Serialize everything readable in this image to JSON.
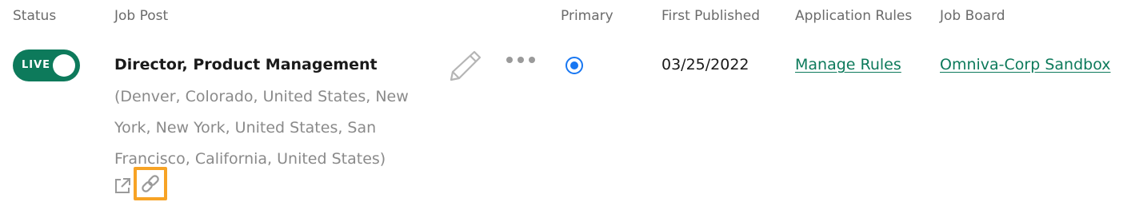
{
  "columns": {
    "status": "Status",
    "job_post": "Job Post",
    "primary": "Primary",
    "first_published": "First Published",
    "application_rules": "Application Rules",
    "job_board": "Job Board"
  },
  "row": {
    "status_label": "LIVE",
    "status_on": true,
    "title": "Director, Product Management",
    "location": "(Denver, Colorado, United States, New York, New York, United States, San Francisco, California, United States)",
    "primary_selected": true,
    "first_published": "03/25/2022",
    "application_rules_link": "Manage Rules",
    "job_board_link": "Omniva-Corp Sandbox"
  },
  "colors": {
    "live_green": "#0d7a5b",
    "radio_blue": "#1877f2",
    "highlight_orange": "#f7a325",
    "muted_text": "#8a8a8a"
  },
  "icons": [
    "external-link-icon",
    "copy-link-icon",
    "pencil-icon",
    "more-options-icon"
  ]
}
